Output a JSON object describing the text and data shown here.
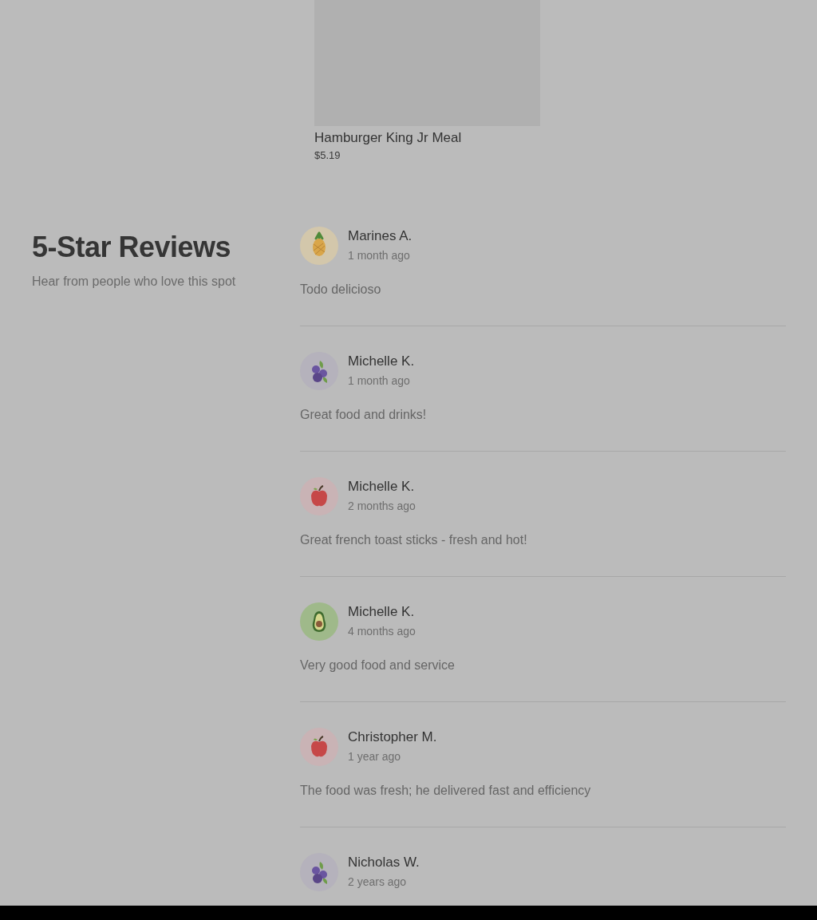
{
  "menu_items": [
    {
      "kind": "placeholder",
      "title": "Hamburger King Jr Meal",
      "price": "$5.19"
    }
  ],
  "reviews_section": {
    "title": "5-Star Reviews",
    "subtitle": "Hear from people who love this spot"
  },
  "reviews": [
    {
      "kind": "pineapple",
      "name": "Marines A.",
      "time": "1 month ago",
      "text": "Todo delicioso"
    },
    {
      "kind": "blueberry",
      "name": "Michelle K.",
      "time": "1 month ago",
      "text": "Great food and drinks!"
    },
    {
      "kind": "apple",
      "name": "Michelle K.",
      "time": "2 months ago",
      "text": "Great french toast sticks - fresh and hot!"
    },
    {
      "kind": "avocado",
      "name": "Michelle K.",
      "time": "4 months ago",
      "text": "Very good food and service"
    },
    {
      "kind": "apple",
      "name": "Christopher M.",
      "time": "1 year ago",
      "text": "The food was fresh; he delivered fast and efficiency"
    },
    {
      "kind": "blueberry",
      "name": "Nicholas W.",
      "time": "2 years ago"
    }
  ]
}
